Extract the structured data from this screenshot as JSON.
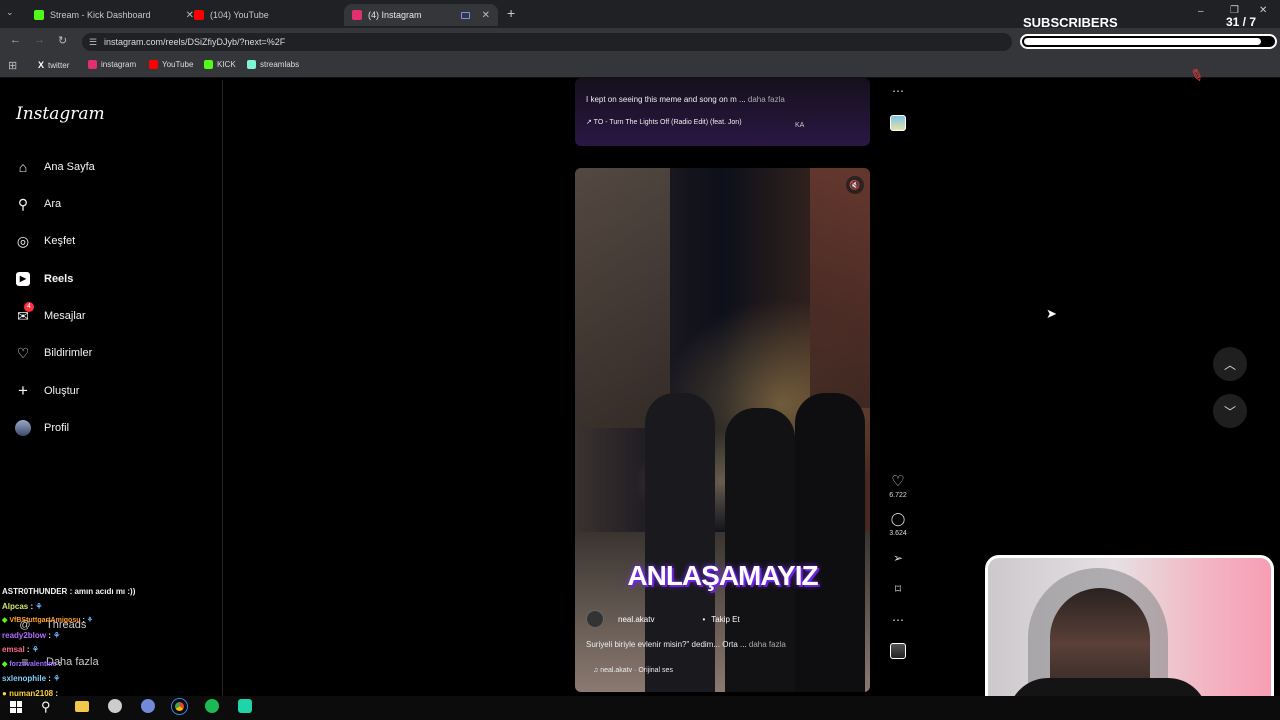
{
  "browser": {
    "tabs": [
      {
        "title": "Stream - Kick Dashboard",
        "color": "#53fc18"
      },
      {
        "title": "(104) YouTube",
        "color": "#ff0000"
      },
      {
        "title": "(4) Instagram",
        "color": "#e1306c"
      }
    ],
    "new_tab": "+",
    "url": "instagram.com/reels/DSiZfiyDJyb/?next=%2F",
    "bookmarks": [
      {
        "label": "twitter",
        "color": "#000000"
      },
      {
        "label": "instagram",
        "color": "#e1306c"
      },
      {
        "label": "YouTube",
        "color": "#ff0000"
      },
      {
        "label": "KICK",
        "color": "#53fc18"
      },
      {
        "label": "streamlabs",
        "color": "#80f5d2"
      }
    ]
  },
  "subscribers": {
    "title": "SUBSCRIBERS",
    "count": "31 / 7",
    "fill": 0.95
  },
  "instagram": {
    "logo": "Instagram",
    "nav": [
      {
        "label": "Ana Sayfa",
        "icon": "home-icon"
      },
      {
        "label": "Ara",
        "icon": "search-icon"
      },
      {
        "label": "Keşfet",
        "icon": "compass-icon"
      },
      {
        "label": "Reels",
        "icon": "reels-icon"
      },
      {
        "label": "Mesajlar",
        "icon": "messenger-icon",
        "badge": "4"
      },
      {
        "label": "Bildirimler",
        "icon": "heart-icon"
      },
      {
        "label": "Oluştur",
        "icon": "plus-icon"
      },
      {
        "label": "Profil",
        "icon": "avatar"
      }
    ],
    "threads": "Threads",
    "more": "Daha fazla"
  },
  "reel_prev": {
    "caption": "I kept on seeing this meme and song on m ...",
    "more": "daha fazla",
    "music": "↗ TO - Turn The Lights Off (Radio Edit) (feat. Jon)",
    "music_tail": "KA"
  },
  "reel_main": {
    "overlay_text": "ANLAŞAMAYIZ",
    "username": "neal.akatv",
    "dot": "•",
    "follow": "Takip Et",
    "caption": "Suriyeli biriyle evlenir misin?\" dedim... Orta ...",
    "more": "daha fazla",
    "audio": "neal.akatv · Orijinal ses",
    "likes": "6.722",
    "comments": "3.624"
  },
  "chat": [
    {
      "user": "ASTR0THUNDER",
      "msg": ": amın acıdı mı :))",
      "color": "#ffffff"
    },
    {
      "user": "Alpcas",
      "msg": ":",
      "color": "#cfe86b"
    },
    {
      "user": "VfBStuttgartAmigosu",
      "msg": ":",
      "color": "#ff9e2c"
    },
    {
      "user": "ready2blow",
      "msg": ":",
      "color": "#b46cff"
    },
    {
      "user": "emsal",
      "msg": ":",
      "color": "#ff6a8a"
    },
    {
      "user": "forzavalentino",
      "msg": ":",
      "color": "#9c6cff"
    },
    {
      "user": "sxlenophile",
      "msg": ":",
      "color": "#7fd0ff"
    },
    {
      "user": "numan2108",
      "msg": ":",
      "color": "#ffd23c"
    }
  ]
}
